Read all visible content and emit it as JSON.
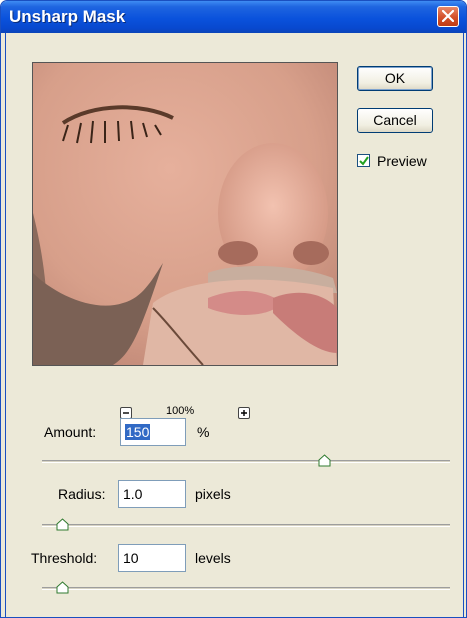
{
  "dialog": {
    "title": "Unsharp Mask",
    "close_icon": "close-icon"
  },
  "buttons": {
    "ok": "OK",
    "cancel": "Cancel"
  },
  "preview_toggle": {
    "label": "Preview",
    "checked": true
  },
  "zoom": {
    "level": "100%",
    "out_icon": "minus-icon",
    "in_icon": "plus-icon"
  },
  "amount": {
    "label": "Amount:",
    "value": "150",
    "unit": "%",
    "slider_fraction": 0.69
  },
  "radius": {
    "label": "Radius:",
    "value": "1.0",
    "unit": "pixels",
    "slider_fraction": 0.05
  },
  "threshold": {
    "label": "Threshold:",
    "value": "10",
    "unit": "levels",
    "slider_fraction": 0.05
  },
  "colors": {
    "title_bar": "#0a52dc",
    "dialog_bg": "#ece9d8",
    "selection": "#316ac5"
  }
}
